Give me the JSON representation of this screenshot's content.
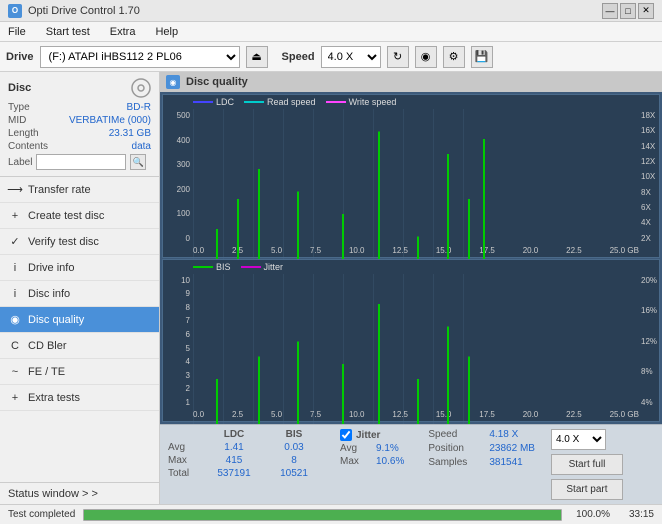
{
  "app": {
    "title": "Opti Drive Control 1.70",
    "title_icon": "O"
  },
  "title_controls": {
    "minimize": "—",
    "maximize": "□",
    "close": "✕"
  },
  "menu": {
    "items": [
      "File",
      "Start test",
      "Extra",
      "Help"
    ]
  },
  "drive_bar": {
    "label": "Drive",
    "drive_value": "(F:)  ATAPI iHBS112  2 PL06",
    "speed_label": "Speed",
    "speed_value": "4.0 X"
  },
  "disc": {
    "title": "Disc",
    "type_label": "Type",
    "type_value": "BD-R",
    "mid_label": "MID",
    "mid_value": "VERBATIMe (000)",
    "length_label": "Length",
    "length_value": "23.31 GB",
    "contents_label": "Contents",
    "contents_value": "data",
    "label_label": "Label",
    "label_input_value": ""
  },
  "nav": {
    "items": [
      {
        "id": "transfer-rate",
        "label": "Transfer rate",
        "icon": "⟶"
      },
      {
        "id": "create-test-disc",
        "label": "Create test disc",
        "icon": "+"
      },
      {
        "id": "verify-test-disc",
        "label": "Verify test disc",
        "icon": "✓"
      },
      {
        "id": "drive-info",
        "label": "Drive info",
        "icon": "i"
      },
      {
        "id": "disc-info",
        "label": "Disc info",
        "icon": "i"
      },
      {
        "id": "disc-quality",
        "label": "Disc quality",
        "icon": "◉",
        "active": true
      },
      {
        "id": "cd-bler",
        "label": "CD Bler",
        "icon": "C"
      },
      {
        "id": "fe-te",
        "label": "FE / TE",
        "icon": "~"
      },
      {
        "id": "extra-tests",
        "label": "Extra tests",
        "icon": "+"
      }
    ],
    "status_window": "Status window > >"
  },
  "quality_panel": {
    "title": "Disc quality",
    "title_icon": "◉",
    "legend_top": [
      {
        "label": "LDC",
        "color": "#0000ff"
      },
      {
        "label": "Read speed",
        "color": "#00ffff"
      },
      {
        "label": "Write speed",
        "color": "#ff00ff"
      }
    ],
    "legend_bottom": [
      {
        "label": "BIS",
        "color": "#00cc00"
      },
      {
        "label": "Jitter",
        "color": "#cc00cc"
      }
    ],
    "top_chart": {
      "y_labels": [
        "500",
        "400",
        "300",
        "200",
        "100",
        "0"
      ],
      "y_labels_right": [
        "18X",
        "16X",
        "14X",
        "12X",
        "10X",
        "8X",
        "6X",
        "4X",
        "2X"
      ],
      "x_labels": [
        "0.0",
        "2.5",
        "5.0",
        "7.5",
        "10.0",
        "12.5",
        "15.0",
        "17.5",
        "20.0",
        "22.5",
        "25.0 GB"
      ]
    },
    "bottom_chart": {
      "y_labels": [
        "10",
        "9",
        "8",
        "7",
        "6",
        "5",
        "4",
        "3",
        "2",
        "1"
      ],
      "y_labels_right": [
        "20%",
        "16%",
        "12%",
        "8%",
        "4%"
      ],
      "x_labels": [
        "0.0",
        "2.5",
        "5.0",
        "7.5",
        "10.0",
        "12.5",
        "15.0",
        "17.5",
        "20.0",
        "22.5",
        "25.0 GB"
      ]
    }
  },
  "stats": {
    "columns": [
      "LDC",
      "BIS"
    ],
    "rows": [
      {
        "label": "Avg",
        "ldc": "1.41",
        "bis": "0.03"
      },
      {
        "label": "Max",
        "ldc": "415",
        "bis": "8"
      },
      {
        "label": "Total",
        "ldc": "537191",
        "bis": "10521"
      }
    ],
    "jitter_checked": true,
    "jitter_label": "Jitter",
    "jitter_rows": [
      {
        "label": "Avg",
        "value": "9.1%"
      },
      {
        "label": "Max",
        "value": "10.6%"
      }
    ],
    "speed_label": "Speed",
    "speed_value": "4.18 X",
    "position_label": "Position",
    "position_value": "23862 MB",
    "samples_label": "Samples",
    "samples_value": "381541",
    "speed_select_label": "4.0 X",
    "btn_start_full": "Start full",
    "btn_start_part": "Start part"
  },
  "bottom_bar": {
    "status_text": "Test completed",
    "progress_percent": 100,
    "progress_display": "100.0%",
    "time": "33:15"
  }
}
